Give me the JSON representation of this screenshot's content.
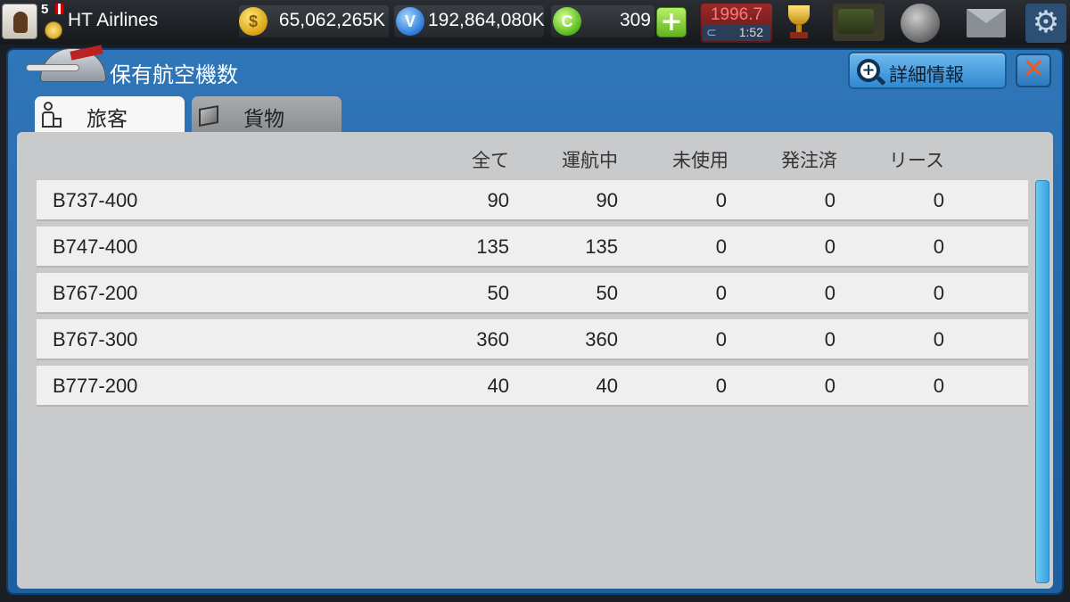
{
  "topbar": {
    "level": "5",
    "airline_name": "HT Airlines",
    "gold_icon_glyph": "$",
    "money": "65,062,265K",
    "v_icon_glyph": "V",
    "v_currency": "192,864,080K",
    "c_icon_glyph": "C",
    "c_currency": "309",
    "plus_glyph": "+",
    "year": "1996.7",
    "time": "1:52",
    "rev_glyph": "⊂",
    "gear_glyph": "⚙"
  },
  "panel": {
    "title": "保有航空機数",
    "detail_button": "詳細情報",
    "detail_icon_glyph": "+",
    "close_glyph": "✕",
    "tabs": [
      {
        "label": "旅客",
        "icon": "passenger-icon",
        "active": true
      },
      {
        "label": "貨物",
        "icon": "cargo-box-icon",
        "active": false
      }
    ],
    "columns": [
      "全て",
      "運航中",
      "未使用",
      "発注済",
      "リース"
    ],
    "rows": [
      {
        "model": "B737-400",
        "all": "90",
        "operating": "90",
        "unused": "0",
        "ordered": "0",
        "lease": "0"
      },
      {
        "model": "B747-400",
        "all": "135",
        "operating": "135",
        "unused": "0",
        "ordered": "0",
        "lease": "0"
      },
      {
        "model": "B767-200",
        "all": "50",
        "operating": "50",
        "unused": "0",
        "ordered": "0",
        "lease": "0"
      },
      {
        "model": "B767-300",
        "all": "360",
        "operating": "360",
        "unused": "0",
        "ordered": "0",
        "lease": "0"
      },
      {
        "model": "B777-200",
        "all": "40",
        "operating": "40",
        "unused": "0",
        "ordered": "0",
        "lease": "0"
      }
    ]
  },
  "colors": {
    "panel_blue": "#2f76b8",
    "close_x": "#f2571c",
    "scrollbar": "#36a4e0"
  }
}
